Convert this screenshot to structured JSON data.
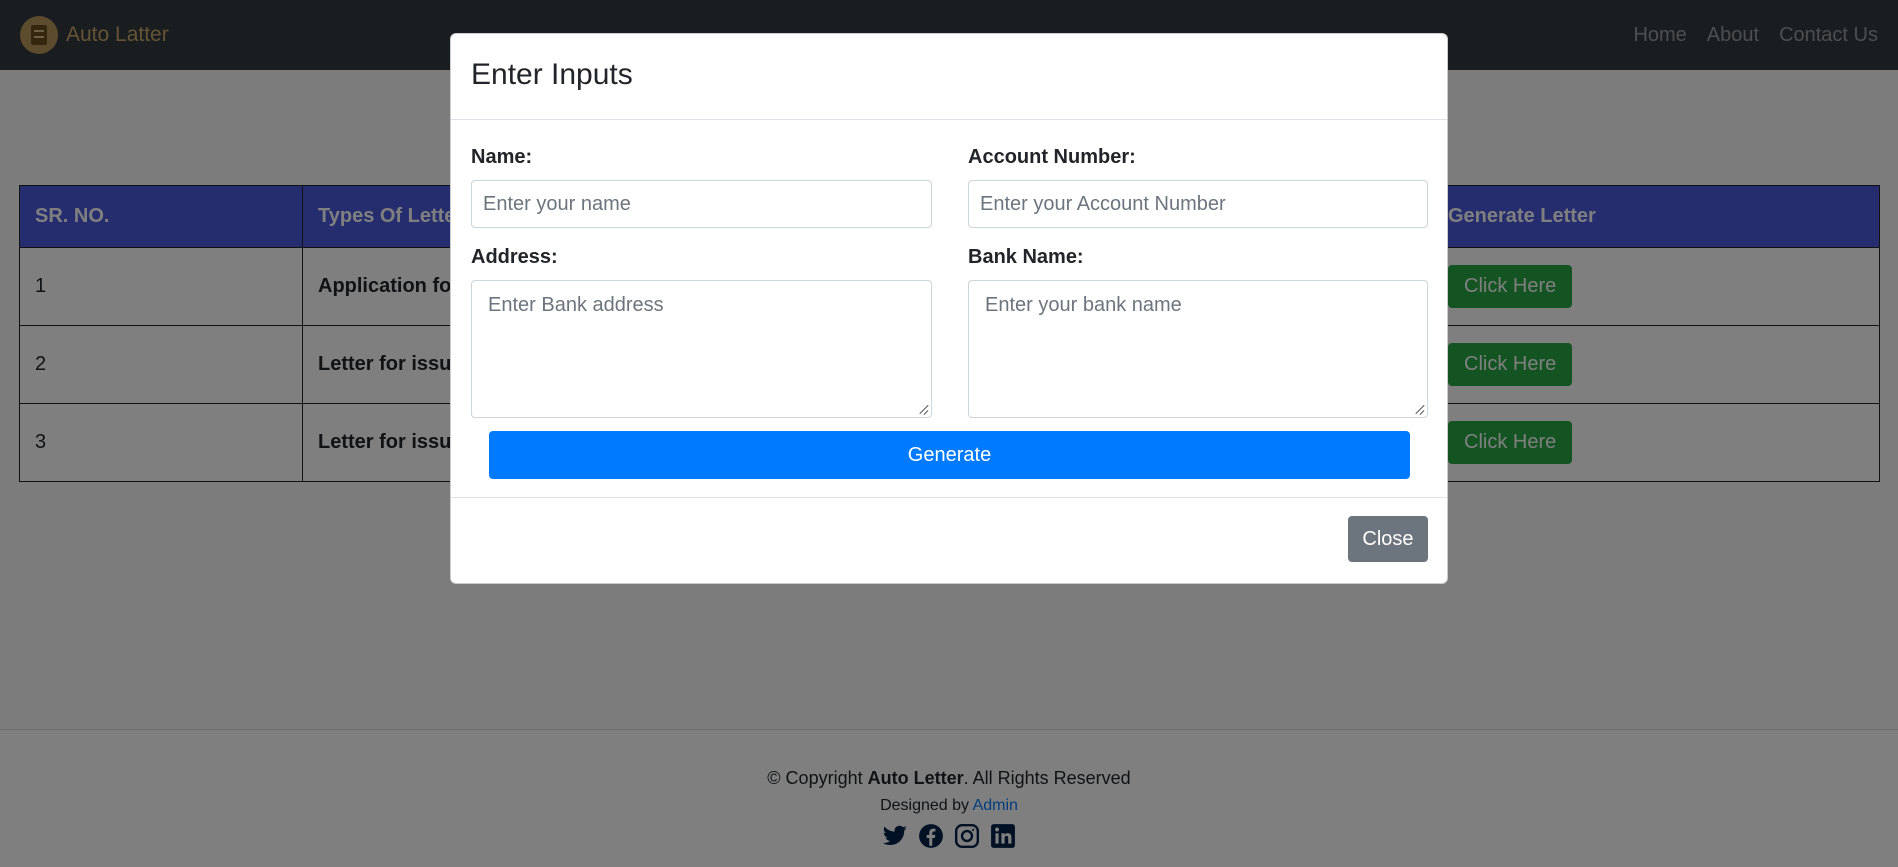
{
  "navbar": {
    "brand": "Auto Latter",
    "links": [
      "Home",
      "About",
      "Contact Us"
    ]
  },
  "table": {
    "headers": [
      "SR. NO.",
      "Types Of Letter",
      "Generate Letter"
    ],
    "rows": [
      {
        "sr": "1",
        "type": "Application fo",
        "action": "Click Here"
      },
      {
        "sr": "2",
        "type": "Letter for issui",
        "action": "Click Here"
      },
      {
        "sr": "3",
        "type": "Letter for issue",
        "action": "Click Here"
      }
    ]
  },
  "modal": {
    "title": "Enter Inputs",
    "name_label": "Name:",
    "name_placeholder": "Enter your name",
    "account_label": "Account Number:",
    "account_placeholder": "Enter your Account Number",
    "address_label": "Address:",
    "address_placeholder": "Enter Bank address",
    "bank_label": "Bank Name:",
    "bank_placeholder": "Enter your bank name",
    "generate_label": "Generate",
    "close_label": "Close"
  },
  "footer": {
    "copy_prefix": "© Copyright ",
    "copy_brand": "Auto Letter",
    "copy_suffix": ". All Rights Reserved",
    "designed_prefix": "Designed by ",
    "designed_link": "Admin",
    "social_icons": [
      "twitter-icon",
      "facebook-icon",
      "instagram-icon",
      "linkedin-icon"
    ]
  },
  "colors": {
    "navbar": "#343a40",
    "table_header": "#4a5bdc",
    "generate": "#007bff",
    "close": "#6c757d",
    "click_here": "#28a745"
  }
}
